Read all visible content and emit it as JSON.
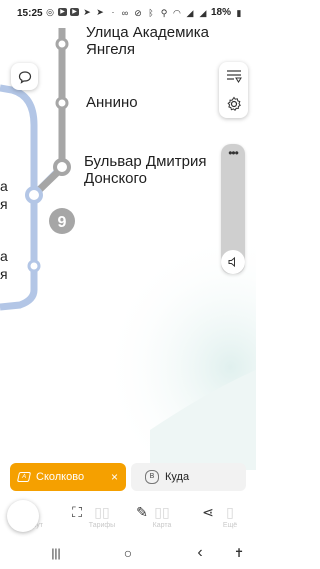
{
  "status_bar": {
    "time": "15:25",
    "battery": "18%",
    "left_icons": [
      "whatsapp-icon",
      "youtube-icon",
      "youtube-icon",
      "telegram-icon",
      "telegram-icon",
      "more-dots-icon"
    ],
    "right_icons": [
      "voicemail-icon",
      "mute-icon",
      "bluetooth-icon",
      "location-icon",
      "wifi-icon",
      "signal-icon",
      "signal-icon",
      "battery-icon"
    ]
  },
  "map": {
    "line_number": "9",
    "stations": [
      {
        "label": "Улица Академика\nЯнгеля"
      },
      {
        "label": "Аннино"
      },
      {
        "label": "Бульвар Дмитрия\nДонского"
      }
    ],
    "side_fragments": [
      "а",
      "я",
      "а",
      "я"
    ],
    "colors": {
      "grey_line": "#a6a6a6",
      "blue_line": "#b3c6e6",
      "orange": "#f5a000"
    }
  },
  "floating": {
    "chat_icon": "chat-bubble-icon",
    "filter_icon": "filter-list-icon",
    "settings_icon": "settings-gear-icon",
    "zoom_more": "•••",
    "zoom_icon": "volume-icon"
  },
  "route": {
    "from": "Сколково",
    "to": "Куда",
    "to_badge": "B",
    "from_badge": "A",
    "close": "×"
  },
  "toolbar": {
    "items": [
      {
        "icon": "favorite-icon",
        "label": "Маршрут"
      },
      {
        "icon": "scan-icon",
        "label": ""
      },
      {
        "icon": "layout-icon",
        "label": "Тарифы"
      },
      {
        "icon": "edit-route-icon",
        "label": ""
      },
      {
        "icon": "grid-icon",
        "label": "Карта"
      },
      {
        "icon": "share-icon",
        "label": ""
      },
      {
        "icon": "more-icon",
        "label": "Ещё"
      }
    ]
  },
  "nav": {
    "recent": "|||",
    "home": "○",
    "back": "‹",
    "accessibility": "accessibility-icon"
  }
}
